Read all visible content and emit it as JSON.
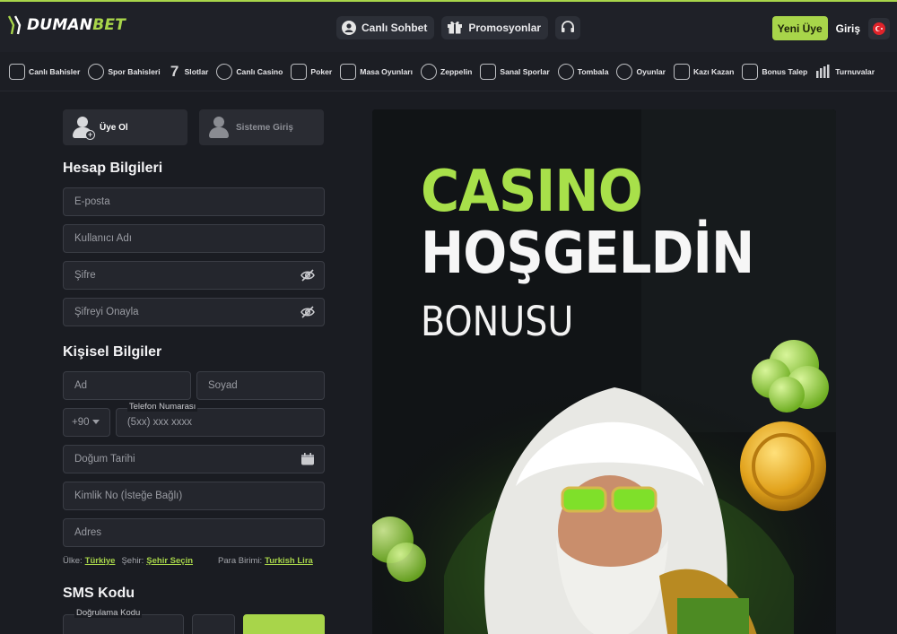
{
  "header": {
    "logo_text_main": "DUMAN",
    "logo_text_accent": "BET",
    "nav": [
      {
        "label": "Canlı Sohbet",
        "icon": "support-agent-icon"
      },
      {
        "label": "Promosyonlar",
        "icon": "gift-icon"
      }
    ],
    "headset_icon": "headset-icon",
    "signup_label": "Yeni Üye",
    "login_label": "Giriş",
    "flag_icon": "turkey-flag-icon"
  },
  "categories": [
    {
      "label": "Canlı Bahisler",
      "icon": "live-bet-icon"
    },
    {
      "label": "Spor Bahisleri",
      "icon": "soccer-ball-icon"
    },
    {
      "label": "Slotlar",
      "icon": "seven-icon"
    },
    {
      "label": "Canlı Casino",
      "icon": "chips-icon"
    },
    {
      "label": "Poker",
      "icon": "cards-icon"
    },
    {
      "label": "Masa Oyunları",
      "icon": "table-game-icon"
    },
    {
      "label": "Zeppelin",
      "icon": "zeppelin-icon"
    },
    {
      "label": "Sanal Sporlar",
      "icon": "virtual-sports-icon"
    },
    {
      "label": "Tombala",
      "icon": "bingo-icon"
    },
    {
      "label": "Oyunlar",
      "icon": "games-icon"
    },
    {
      "label": "Kazı Kazan",
      "icon": "scratch-card-icon"
    },
    {
      "label": "Bonus Talep",
      "icon": "bonus-icon"
    },
    {
      "label": "Turnuvalar",
      "icon": "leaderboard-icon"
    }
  ],
  "form": {
    "tab_signup": "Üye Ol",
    "tab_login": "Sisteme Giriş",
    "account_title": "Hesap Bilgileri",
    "email_placeholder": "E-posta",
    "username_placeholder": "Kullanıcı Adı",
    "password_placeholder": "Şifre",
    "password_confirm_placeholder": "Şifreyi Onayla",
    "personal_title": "Kişisel Bilgiler",
    "first_name_placeholder": "Ad",
    "last_name_placeholder": "Soyad",
    "phone_code": "+90",
    "phone_label": "Telefon Numarası",
    "phone_placeholder": "(5xx) xxx xxxx",
    "birthdate_placeholder": "Doğum Tarihi",
    "id_placeholder": "Kimlik No (İsteğe Bağlı)",
    "address_placeholder": "Adres",
    "country_label": "Ülke:",
    "country_value": "Türkiye",
    "city_label": "Şehir:",
    "city_value": "Şehir Seçin",
    "currency_label": "Para Birimi:",
    "currency_value": "Turkish Lira",
    "sms_title": "SMS Kodu",
    "verification_label": "Doğrulama Kodu"
  },
  "banner": {
    "line1": "CASINO",
    "line2": "HOŞGELDİN",
    "line3": "BONUSU"
  },
  "colors": {
    "accent": "#a8d54a",
    "background": "#1a1c22",
    "header": "#1f2128",
    "field": "#24262d"
  }
}
